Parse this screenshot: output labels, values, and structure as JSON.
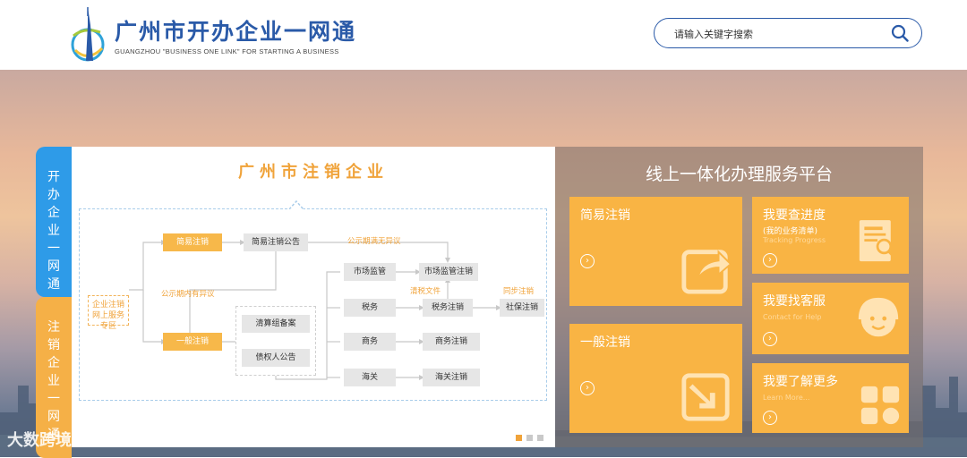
{
  "header": {
    "logo_title": "广州市开办企业一网通",
    "logo_subtitle": "GUANGZHOU \"BUSINESS ONE LINK\" FOR STARTING A BUSINESS",
    "logo_icon": "canton-tower-logo",
    "search": {
      "placeholder": "请输入关键字搜索",
      "icon": "search-icon"
    }
  },
  "side_tabs": [
    {
      "label": "开办企业一网通",
      "color": "#2e9be8",
      "active": true
    },
    {
      "label": "注销企业一网通",
      "color": "#f5b047",
      "active": false
    }
  ],
  "flow_panel": {
    "title": "广州市注销企业",
    "boxes": {
      "start": "企业注销网上服务专区",
      "simple": "简易注销",
      "simple_notice": "简易注销公告",
      "general": "一般注销",
      "liquidation": "清算组备案",
      "creditor": "债权人公告",
      "market": "市场监管",
      "tax": "税务",
      "commerce": "商务",
      "customs": "海关",
      "market_cancel": "市场监管注销",
      "tax_cancel": "税务注销",
      "commerce_cancel": "商务注销",
      "customs_cancel": "海关注销",
      "social_cancel": "社保注销"
    },
    "labels": {
      "no_objection": "公示期满无异议",
      "objection": "公示期内有异议",
      "clearance": "清税文件",
      "sync": "同步注销"
    },
    "carousel": {
      "count": 3,
      "active_index": 0
    }
  },
  "services": {
    "title": "线上一体化办理服务平台",
    "tiles": {
      "simple": {
        "label": "简易注销",
        "icon": "share-arrow-icon"
      },
      "general": {
        "label": "一般注销",
        "icon": "download-arrow-icon"
      },
      "progress": {
        "label": "我要查进度",
        "sub": "(我的业务清单)",
        "en": "Tracking Progress",
        "icon": "document-search-icon"
      },
      "support": {
        "label": "我要找客服",
        "en": "Contact for Help",
        "icon": "customer-service-icon"
      },
      "more": {
        "label": "我要了解更多",
        "en": "Learn More...",
        "icon": "grid-tiles-icon"
      }
    },
    "arrow": "›"
  },
  "watermark": "大数跨境",
  "colors": {
    "brand_blue": "#2a5aa8",
    "tab_blue": "#2e9be8",
    "accent_orange": "#f9b444"
  }
}
